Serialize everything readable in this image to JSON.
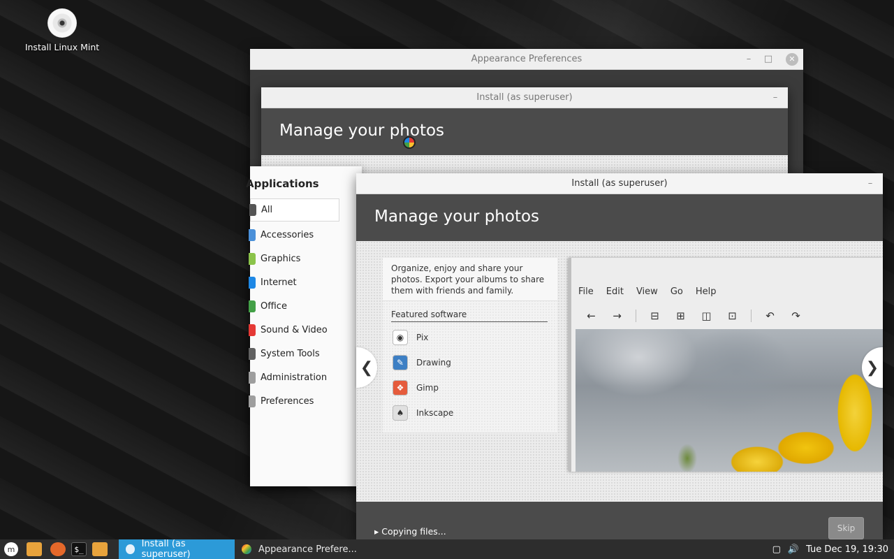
{
  "desktop": {
    "icon_label": "Install Linux Mint"
  },
  "appearance_window": {
    "title": "Appearance Preferences"
  },
  "install_back": {
    "title": "Install (as superuser)",
    "banner": "Manage your photos"
  },
  "menu": {
    "heading": "Applications",
    "categories": [
      {
        "label": "All",
        "color": "#555555"
      },
      {
        "label": "Accessories",
        "color": "#4a90d9"
      },
      {
        "label": "Graphics",
        "color": "#8bc34a"
      },
      {
        "label": "Internet",
        "color": "#1e88e5"
      },
      {
        "label": "Office",
        "color": "#43a047"
      },
      {
        "label": "Sound & Video",
        "color": "#e53935"
      },
      {
        "label": "System Tools",
        "color": "#616161"
      },
      {
        "label": "Administration",
        "color": "#9e9e9e"
      },
      {
        "label": "Preferences",
        "color": "#9e9e9e"
      }
    ]
  },
  "install_front": {
    "title": "Install (as superuser)",
    "banner": "Manage your photos",
    "description": "Organize, enjoy and share your photos. Export your albums to share them with friends and family.",
    "featured_heading": "Featured software",
    "apps": [
      {
        "label": "Pix",
        "icon": "pix-icon",
        "color": "#ffffff"
      },
      {
        "label": "Drawing",
        "icon": "drawing-icon",
        "color": "#3d7fc4"
      },
      {
        "label": "Gimp",
        "icon": "gimp-icon",
        "color": "#e55b3c"
      },
      {
        "label": "Inkscape",
        "icon": "inkscape-icon",
        "color": "#e0e0e0"
      }
    ],
    "screenshot_menu": [
      "File",
      "Edit",
      "View",
      "Go",
      "Help"
    ],
    "copying": "Copying files...",
    "skip": "Skip"
  },
  "taskbar": {
    "tasks": [
      {
        "label": "Install (as superuser)"
      },
      {
        "label": "Appearance Prefere..."
      }
    ],
    "clock": "Tue Dec 19, 19:30"
  }
}
